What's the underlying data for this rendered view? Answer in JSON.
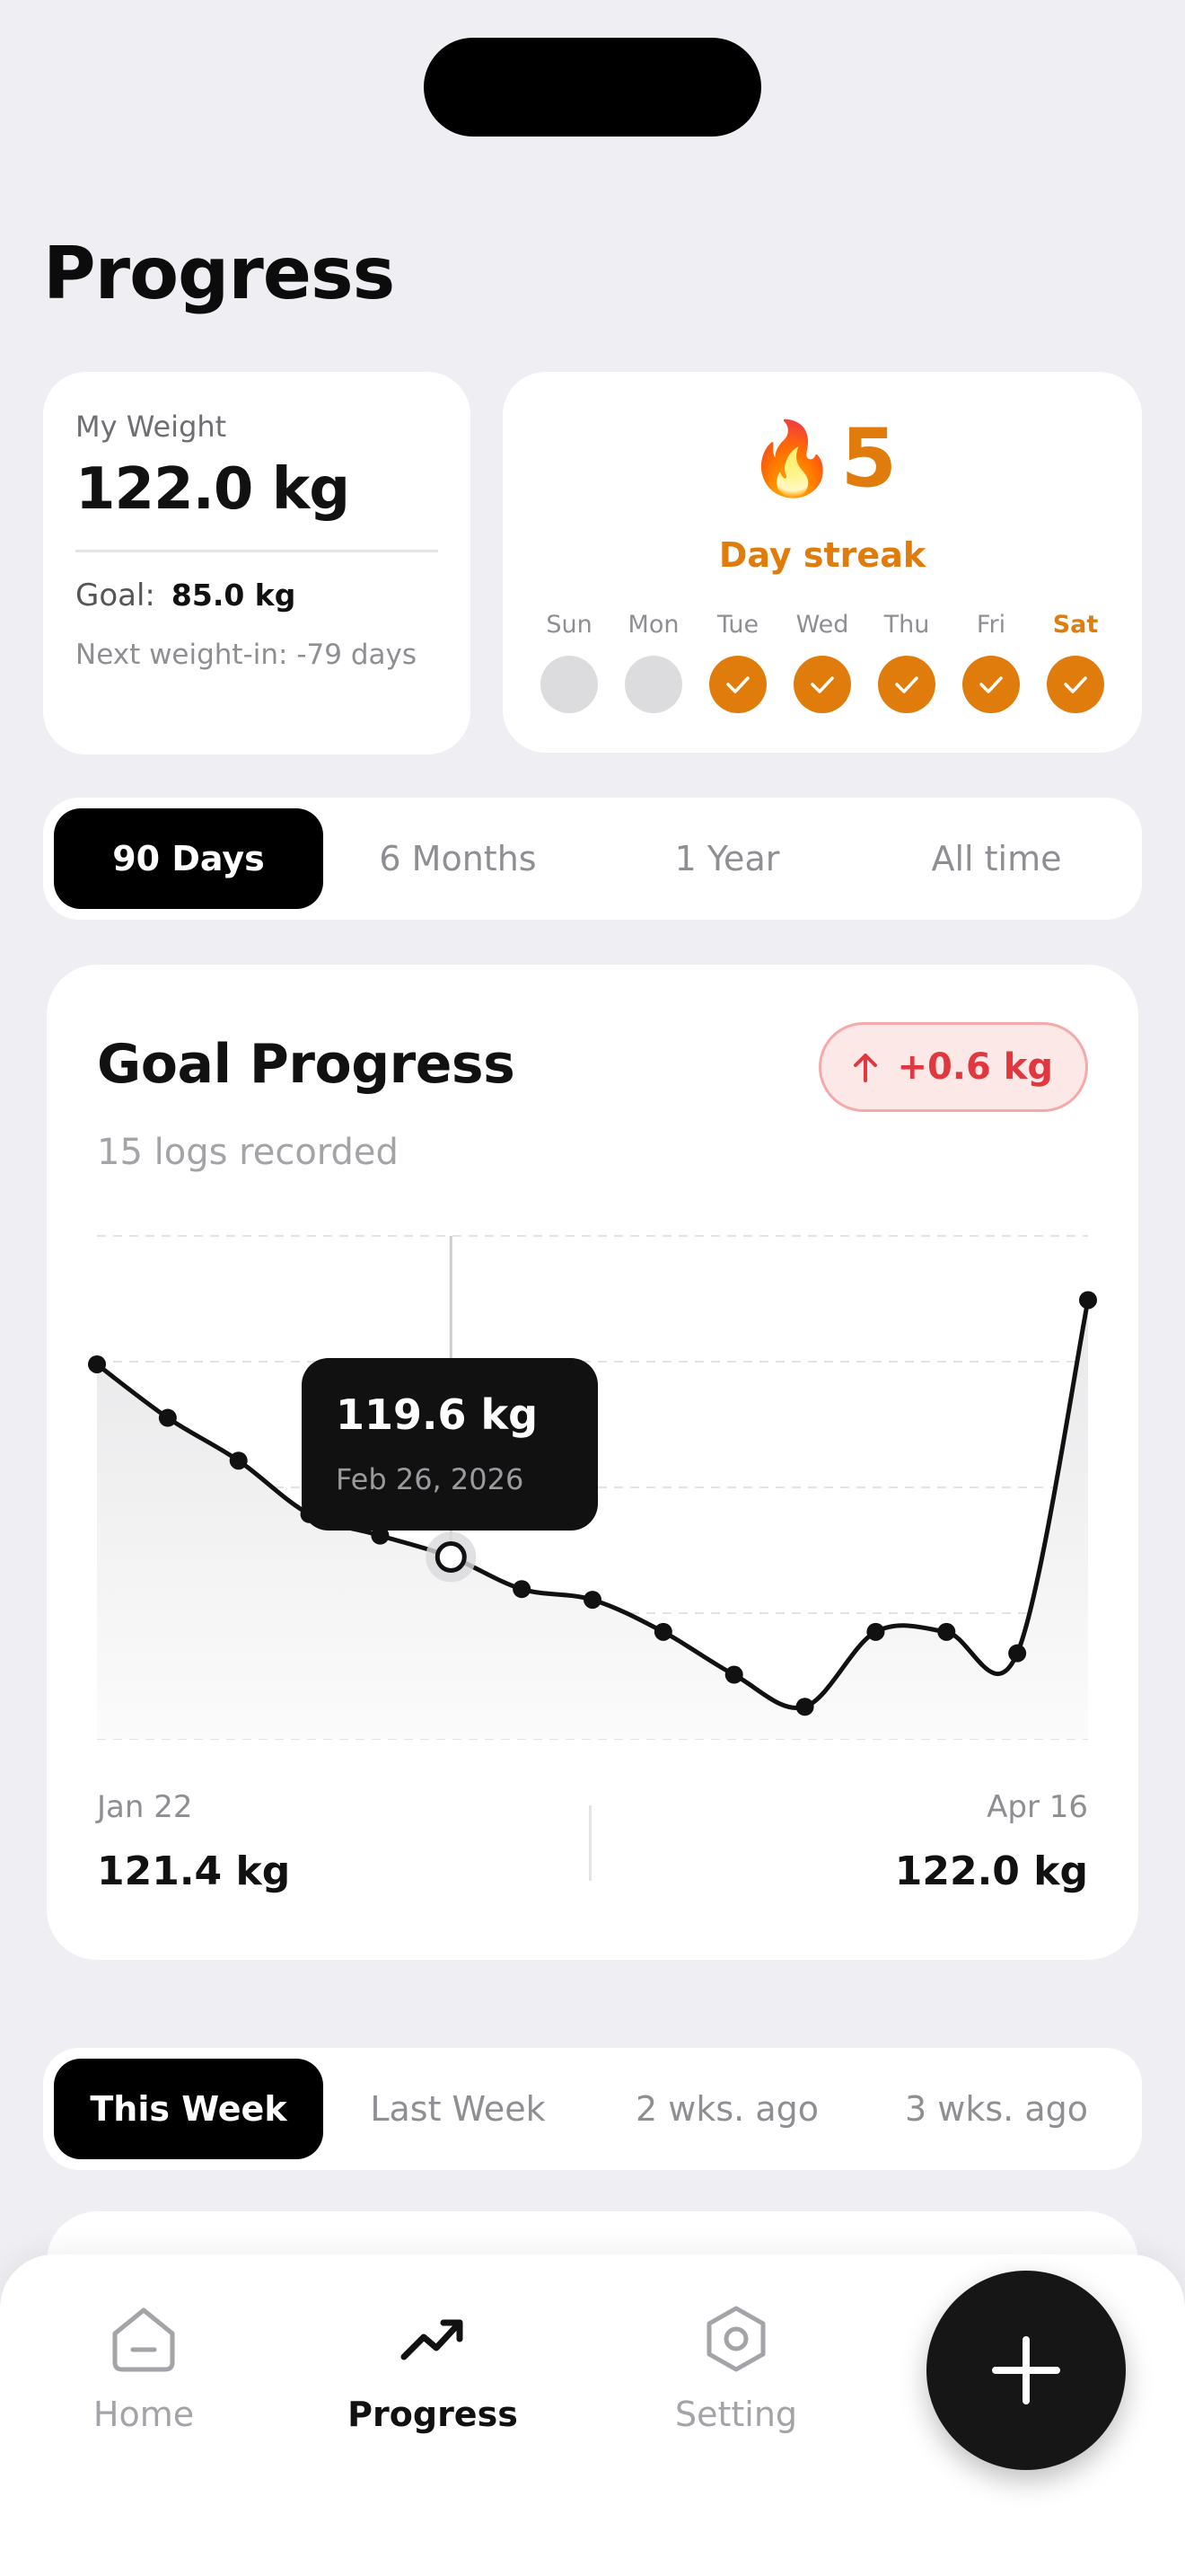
{
  "page": {
    "title": "Progress"
  },
  "weight_card": {
    "label": "My Weight",
    "value": "122.0 kg",
    "goal_label": "Goal:",
    "goal_value": "85.0 kg",
    "next_weigh_in": "Next weight-in: -79 days"
  },
  "streak": {
    "count": "5",
    "label": "Day streak",
    "days": [
      {
        "name": "Sun",
        "done": false
      },
      {
        "name": "Mon",
        "done": false
      },
      {
        "name": "Tue",
        "done": true
      },
      {
        "name": "Wed",
        "done": true
      },
      {
        "name": "Thu",
        "done": true
      },
      {
        "name": "Fri",
        "done": true
      },
      {
        "name": "Sat",
        "done": true,
        "today": true
      }
    ],
    "accent_color": "#e07c0c"
  },
  "range_tabs": {
    "options": [
      "90 Days",
      "6 Months",
      "1 Year",
      "All time"
    ],
    "selected": "90 Days"
  },
  "goal_progress": {
    "title": "Goal Progress",
    "subtitle": "15 logs recorded",
    "change_badge": "+0.6 kg",
    "change_color": "#e0383e",
    "tooltip": {
      "value": "119.6 kg",
      "date": "Feb 26, 2026"
    },
    "start": {
      "date": "Jan 22",
      "value": "121.4 kg"
    },
    "end": {
      "date": "Apr 16",
      "value": "122.0 kg"
    }
  },
  "chart_data": {
    "type": "line",
    "title": "Goal Progress",
    "x": [
      "Jan 22",
      "",
      "",
      "",
      "",
      "Feb 26",
      "",
      "",
      "",
      "",
      "",
      "",
      "",
      "",
      "Apr 16"
    ],
    "series": [
      {
        "values": [
          121.4,
          120.9,
          120.5,
          120.0,
          119.8,
          119.6,
          119.3,
          119.2,
          118.9,
          118.5,
          118.2,
          118.9,
          118.9,
          118.7,
          122.0
        ]
      }
    ],
    "highlight_index": 5,
    "ylim": [
      117.9,
      122.6
    ],
    "grid": true,
    "grid_style": "dashed horizontal"
  },
  "week_tabs": {
    "options": [
      "This Week",
      "Last Week",
      "2 wks. ago",
      "3 wks. ago"
    ],
    "selected": "This Week"
  },
  "tabbar": {
    "items": [
      {
        "label": "Home",
        "icon": "home-icon",
        "active": false
      },
      {
        "label": "Progress",
        "icon": "trending-up-icon",
        "active": true
      },
      {
        "label": "Setting",
        "icon": "settings-hexagon-icon",
        "active": false
      }
    ],
    "fab_icon": "plus-icon"
  }
}
